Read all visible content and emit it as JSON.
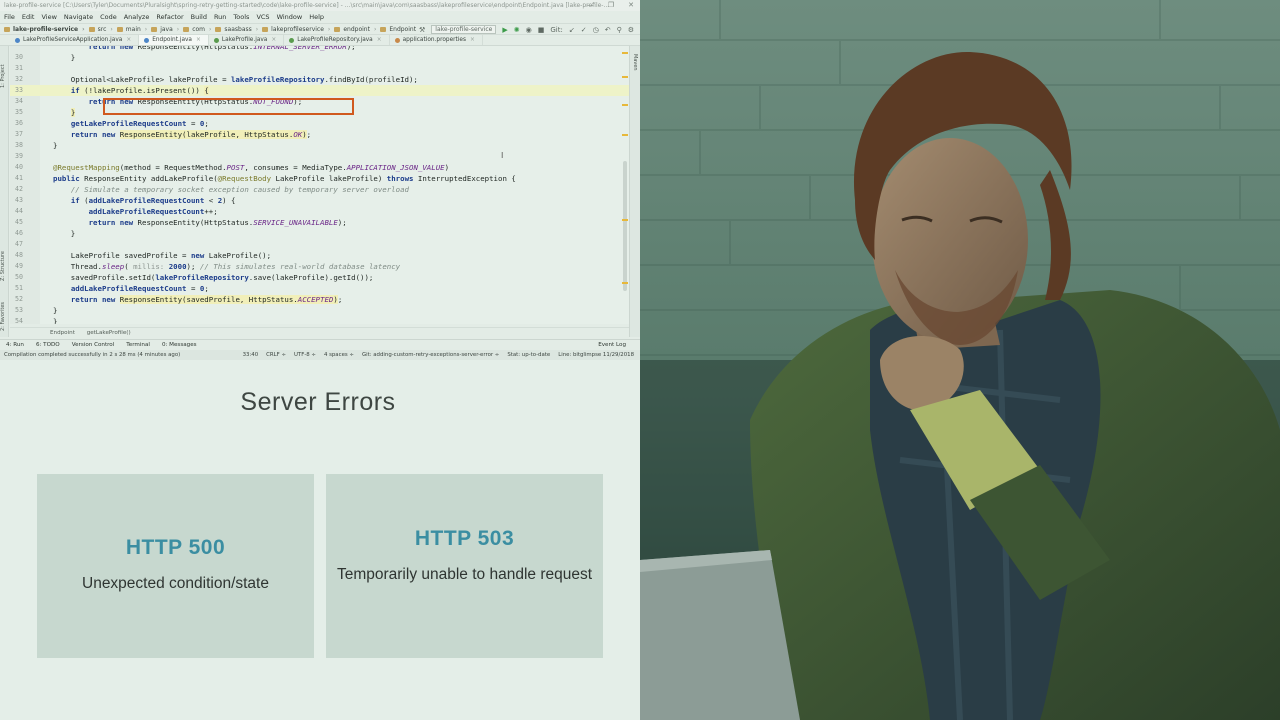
{
  "ide": {
    "title": "lake-profile-service [C:\\Users\\Tyler\\Documents\\Pluralsight\\spring-retry-getting-started\\code\\lake-profile-service] - ...\\src\\main\\java\\com\\saasbass\\lakeprofileservice\\endpoint\\Endpoint.java [lake-profile-...",
    "menu": [
      "File",
      "Edit",
      "View",
      "Navigate",
      "Code",
      "Analyze",
      "Refactor",
      "Build",
      "Run",
      "Tools",
      "VCS",
      "Window",
      "Help"
    ],
    "breadcrumbs": [
      "lake-profile-service",
      "src",
      "main",
      "java",
      "com",
      "saasbass",
      "lakeprofileservice",
      "endpoint",
      "Endpoint"
    ],
    "run_config": "lake-profile-service",
    "git_label": "Git:",
    "tabs": [
      {
        "label": "LakeProfileServiceApplication.java",
        "active": false
      },
      {
        "label": "Endpoint.java",
        "active": true
      },
      {
        "label": "LakeProfile.java",
        "active": false
      },
      {
        "label": "LakeProfileRepository.java",
        "active": false
      },
      {
        "label": "application.properties",
        "active": false
      }
    ],
    "left_strip": [
      "1: Project",
      "Z: Structure",
      "2: Favorites"
    ],
    "right_strip": "Maven",
    "code_lines": [
      {
        "n": "",
        "html": "        <span class='kw'>return new</span> ResponseEntity(HttpStatus.<span class='st'>INTERNAL_SERVER_ERROR</span>);"
      },
      {
        "n": "30",
        "html": "    }"
      },
      {
        "n": "31",
        "html": ""
      },
      {
        "n": "32",
        "html": "    Optional&lt;LakeProfile&gt; lakeProfile = <span class='kw'>lakeProfileRepository</span>.findById(profileId);"
      },
      {
        "n": "33",
        "html": "    <span class='kw'>if</span> (!lakeProfile.isPresent()) <span class='hlspan'>{</span>",
        "hl": true
      },
      {
        "n": "34",
        "html": "        <span class='kw'>return new</span> ResponseEntity(HttpStatus.<span class='st'>NOT_FOUND</span>);"
      },
      {
        "n": "35",
        "html": "    <span class='hlspan'>}</span>"
      },
      {
        "n": "36",
        "html": "    <span class='kw'>getLakeProfileRequestCount</span> = <span class='kw'>0</span>;"
      },
      {
        "n": "37",
        "html": "    <span class='kw'>return new</span> <span class='hlspan'>ResponseEntity(lakeProfile, HttpStatus.<span class='st'>OK</span>)</span>;"
      },
      {
        "n": "38",
        "html": "}"
      },
      {
        "n": "39",
        "html": ""
      },
      {
        "n": "40",
        "html": "<span class='an'>@RequestMapping</span>(method = RequestMethod.<span class='st'>POST</span>, consumes = MediaType.<span class='st'>APPLICATION_JSON_VALUE</span>)"
      },
      {
        "n": "41",
        "html": "<span class='kw'>public</span> ResponseEntity <span class='fn'>addLakeProfile</span>(<span class='an'>@RequestBody</span> LakeProfile lakeProfile) <span class='kw'>throws</span> InterruptedException {"
      },
      {
        "n": "42",
        "html": "    <span class='cm'>// Simulate a temporary socket exception caused by temporary server overload</span>"
      },
      {
        "n": "43",
        "html": "    <span class='kw'>if</span> (<span class='kw'>addLakeProfileRequestCount</span> &lt; <span class='kw'>2</span>) {"
      },
      {
        "n": "44",
        "html": "        <span class='kw'>addLakeProfileRequestCount</span>++;"
      },
      {
        "n": "45",
        "html": "        <span class='kw'>return new</span> ResponseEntity(HttpStatus.<span class='st'>SERVICE_UNAVAILABLE</span>);"
      },
      {
        "n": "46",
        "html": "    }"
      },
      {
        "n": "47",
        "html": ""
      },
      {
        "n": "48",
        "html": "    LakeProfile savedProfile = <span class='kw'>new</span> LakeProfile();"
      },
      {
        "n": "49",
        "html": "    Thread.<span class='st'>sleep</span>( <span class='pa'>millis:</span> <span class='kw'>2000</span>); <span class='cm'>// This simulates real-world database latency</span>"
      },
      {
        "n": "50",
        "html": "    savedProfile.setId(<span class='kw'>lakeProfileRepository</span>.save(lakeProfile).getId());"
      },
      {
        "n": "51",
        "html": "    <span class='kw'>addLakeProfileRequestCount</span> = <span class='kw'>0</span>;"
      },
      {
        "n": "52",
        "html": "    <span class='kw'>return new</span> <span class='hlspan'>ResponseEntity(savedProfile, HttpStatus.<span class='st'>ACCEPTED</span>)</span>;"
      },
      {
        "n": "53",
        "html": "}"
      },
      {
        "n": "54",
        "html": "}"
      }
    ],
    "editor_breadcrumb": [
      "Endpoint",
      "getLakeProfile()"
    ],
    "toolwindows": [
      "4: Run",
      "6: TODO",
      "Version Control",
      "Terminal",
      "0: Messages"
    ],
    "event_log": "Event Log",
    "status_message": "Compilation completed successfully in 2 s 28 ms (4 minutes ago)",
    "status_right": [
      "33:40",
      "CRLF ÷",
      "UTF-8 ÷",
      "4 spaces ÷",
      "Git: adding-custom-retry-exceptions-server-error ÷",
      "Stat: up-to-date",
      "Line: bitglimpse 11/29/2018"
    ]
  },
  "slide": {
    "title": "Server Errors",
    "cards": [
      {
        "code": "HTTP 500",
        "desc": "Unexpected condition/state"
      },
      {
        "code": "HTTP 503",
        "desc": "Temporarily unable to handle request"
      }
    ]
  },
  "colors": {
    "accent_code": "#3b8ea2",
    "card_bg": "#c7d8cf",
    "highlight_box": "#d0591e"
  }
}
